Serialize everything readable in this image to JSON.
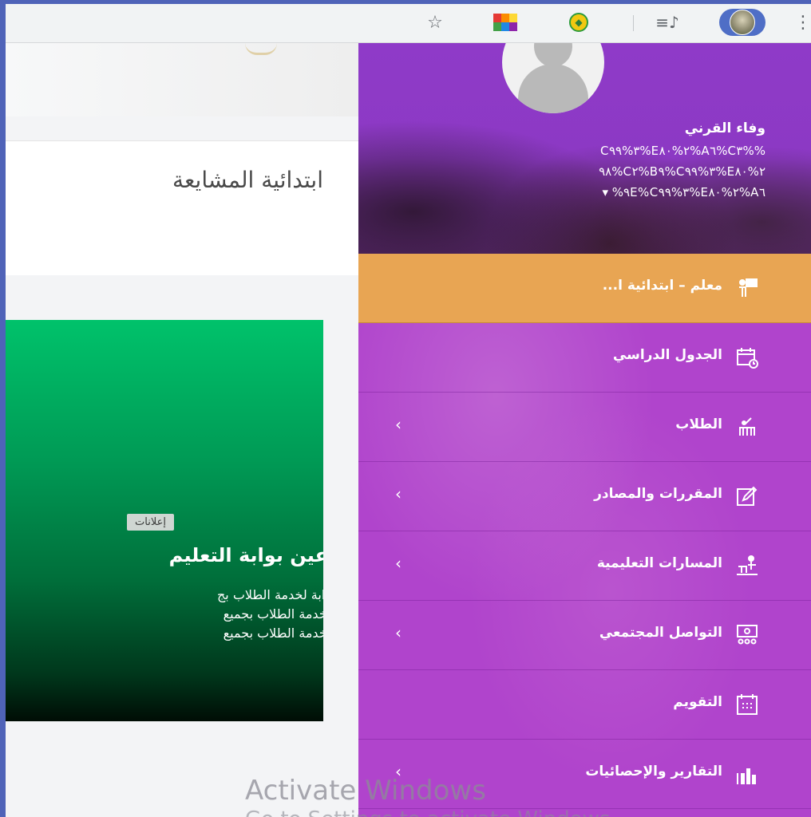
{
  "toolbar": {
    "icons": [
      "star-icon",
      "extension-grid-icon",
      "extension-round-icon",
      "media-queue-icon",
      "profile-avatar-icon",
      "more-vert-icon"
    ]
  },
  "page": {
    "school_name": "ابتدائية المشايعة"
  },
  "card": {
    "badge": "إعلانات",
    "title": "عين بوابة التعليم",
    "lines": [
      "وابة لخدمة الطلاب بج",
      "لخدمة الطلاب بجميع",
      "لخدمة الطلاب بجميع"
    ]
  },
  "sidebar": {
    "user_name": "وفاء القرني",
    "user_sub": [
      "C٣%٩٩%E٢%٨٠%A٦%C٣%%",
      "٩٨%C٢%B٩%C٣%٩٩%E٢%٨٠",
      "▾ %٩E%C٣%٩٩%E٢%٨٠%A٦"
    ],
    "items": [
      {
        "label": "معلم – ابتدائية ا...",
        "icon": "teacher-icon",
        "chevron": ""
      },
      {
        "label": "الجدول الدراسي",
        "icon": "schedule-icon",
        "chevron": ""
      },
      {
        "label": "الطلاب",
        "icon": "students-icon",
        "chevron": "‹"
      },
      {
        "label": "المقررات والمصادر",
        "icon": "courses-icon",
        "chevron": "‹"
      },
      {
        "label": "المسارات التعليمية",
        "icon": "paths-icon",
        "chevron": "‹"
      },
      {
        "label": "التواصل المجتمعي",
        "icon": "community-icon",
        "chevron": "‹"
      },
      {
        "label": "التقويم",
        "icon": "calendar-icon",
        "chevron": ""
      },
      {
        "label": "التقارير والإحصائيات",
        "icon": "reports-icon",
        "chevron": "‹"
      }
    ]
  },
  "watermark": {
    "line1": "Activate Windows",
    "line2": "Go to Settings to activate Windows."
  },
  "colors": {
    "menu_purple": "#b044cc",
    "menu_active": "#e8a553",
    "card_green": "#00c26b"
  }
}
